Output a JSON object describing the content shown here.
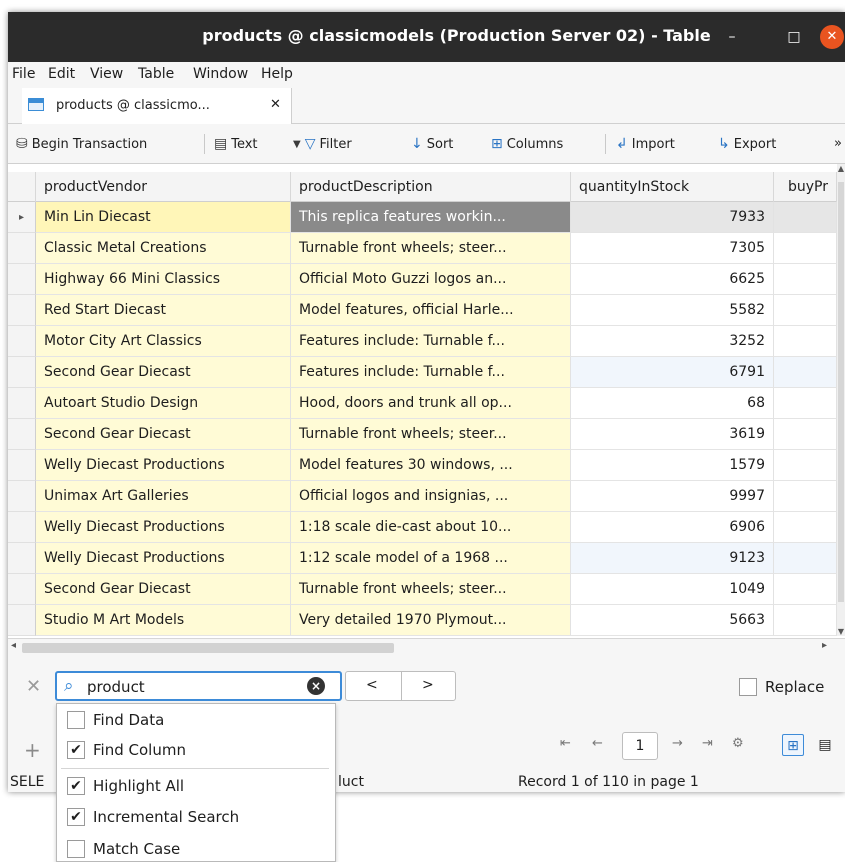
{
  "window": {
    "title": "products @ classicmodels (Production Server 02) - Table",
    "minimize": "–",
    "maximize": "□",
    "close": "✕"
  },
  "menu": [
    "File",
    "Edit",
    "View",
    "Table",
    "Window",
    "Help"
  ],
  "tab": {
    "label": "products @ classicmo...",
    "close": "✕"
  },
  "toolbar": {
    "begin_transaction": "Begin Transaction",
    "text": "Text",
    "filter": "Filter",
    "sort": "Sort",
    "columns": "Columns",
    "import": "Import",
    "export": "Export",
    "more": "»"
  },
  "grid": {
    "columns": [
      "productVendor",
      "productDescription",
      "quantityInStock",
      "buyPr"
    ],
    "selected_marker": "▸",
    "rows": [
      {
        "vendor": "Min Lin Diecast",
        "desc": "This replica features workin...",
        "qty": "7933"
      },
      {
        "vendor": "Classic Metal Creations",
        "desc": "Turnable front wheels; steer...",
        "qty": "7305"
      },
      {
        "vendor": "Highway 66 Mini Classics",
        "desc": "Official Moto Guzzi logos an...",
        "qty": "6625"
      },
      {
        "vendor": "Red Start Diecast",
        "desc": "Model features, official Harle...",
        "qty": "5582"
      },
      {
        "vendor": "Motor City Art Classics",
        "desc": "Features include: Turnable f...",
        "qty": "3252"
      },
      {
        "vendor": "Second Gear Diecast",
        "desc": "Features include: Turnable f...",
        "qty": "6791"
      },
      {
        "vendor": "Autoart Studio Design",
        "desc": "Hood, doors and trunk all op...",
        "qty": "68"
      },
      {
        "vendor": "Second Gear Diecast",
        "desc": "Turnable front wheels; steer...",
        "qty": "3619"
      },
      {
        "vendor": "Welly Diecast Productions",
        "desc": "Model features 30 windows, ...",
        "qty": "1579"
      },
      {
        "vendor": "Unimax Art Galleries",
        "desc": "Official logos and insignias, ...",
        "qty": "9997"
      },
      {
        "vendor": "Welly Diecast Productions",
        "desc": "1:18 scale die-cast about 10...",
        "qty": "6906"
      },
      {
        "vendor": "Welly Diecast Productions",
        "desc": "1:12 scale model of a 1968 ...",
        "qty": "9123"
      },
      {
        "vendor": "Second Gear Diecast",
        "desc": "Turnable front wheels; steer...",
        "qty": "1049"
      },
      {
        "vendor": "Studio M Art Models",
        "desc": "Very detailed 1970 Plymout...",
        "qty": "5663"
      }
    ]
  },
  "find": {
    "close": "✕",
    "value": "product",
    "clear": "×",
    "prev": "<",
    "next": ">",
    "replace_label": "Replace"
  },
  "pager": {
    "first": "⇤",
    "prev": "←",
    "page": "1",
    "next": "→",
    "last": "⇥",
    "settings": "⚙",
    "add": "+"
  },
  "status": {
    "left": "SELE",
    "mid": "luct",
    "record": "Record 1 of 110 in page 1"
  },
  "dropdown": {
    "items": [
      {
        "label": "Find Data",
        "checked": false
      },
      {
        "label": "Find Column",
        "checked": true
      },
      {
        "label": "Highlight All",
        "checked": true
      },
      {
        "label": "Incremental Search",
        "checked": true
      },
      {
        "label": "Match Case",
        "checked": false
      }
    ],
    "check": "✔"
  }
}
